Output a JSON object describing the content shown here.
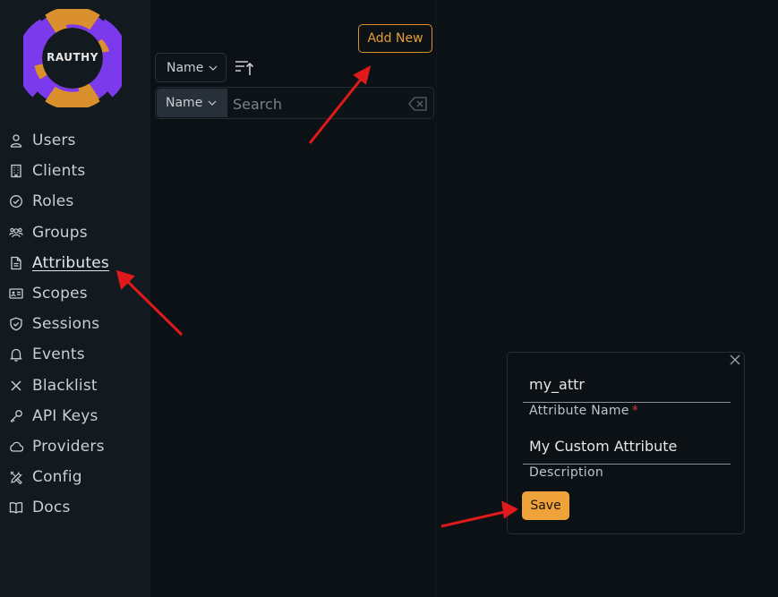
{
  "logo": {
    "text": "RAUTHY"
  },
  "sidebar": {
    "items": [
      {
        "label": "Users",
        "icon": "user-icon"
      },
      {
        "label": "Clients",
        "icon": "building-icon"
      },
      {
        "label": "Roles",
        "icon": "check-circle-icon"
      },
      {
        "label": "Groups",
        "icon": "users-group-icon"
      },
      {
        "label": "Attributes",
        "icon": "document-icon",
        "active": true
      },
      {
        "label": "Scopes",
        "icon": "id-card-icon"
      },
      {
        "label": "Sessions",
        "icon": "shield-check-icon"
      },
      {
        "label": "Events",
        "icon": "bell-icon"
      },
      {
        "label": "Blacklist",
        "icon": "x-icon"
      },
      {
        "label": "API Keys",
        "icon": "key-icon"
      },
      {
        "label": "Providers",
        "icon": "cloud-icon"
      },
      {
        "label": "Config",
        "icon": "tools-icon"
      },
      {
        "label": "Docs",
        "icon": "book-icon"
      }
    ]
  },
  "toolbar": {
    "add_new_label": "Add New",
    "sort_by": "Name"
  },
  "search": {
    "field": "Name",
    "placeholder": "Search",
    "value": ""
  },
  "dialog": {
    "name_value": "my_attr",
    "name_label": "Attribute Name",
    "name_required": "*",
    "description_value": "My Custom Attribute",
    "description_label": "Description",
    "save_label": "Save"
  },
  "colors": {
    "accent": "#f0a23a",
    "logo_orange": "#d9902d",
    "logo_purple": "#7c3aed",
    "annotation_arrow": "#e0191b"
  }
}
